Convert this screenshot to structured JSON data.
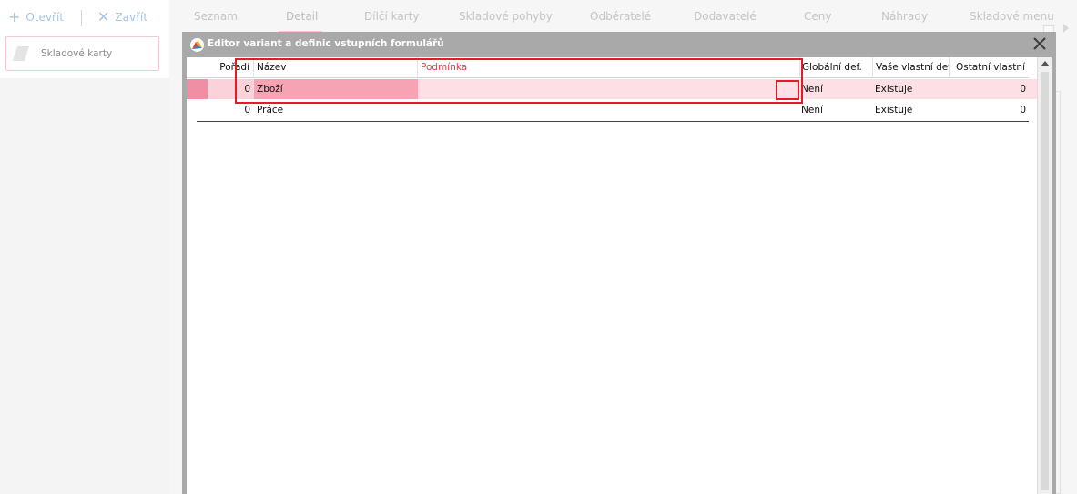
{
  "toolbar": {
    "open_label": "Otevřít",
    "close_label": "Zavřít"
  },
  "module_card": {
    "label": "Skladové karty"
  },
  "tabs": [
    {
      "label": "Seznam"
    },
    {
      "label": "Detail",
      "active": true
    },
    {
      "label": "Dílčí karty"
    },
    {
      "label": "Skladové pohyby"
    },
    {
      "label": "Odběratelé"
    },
    {
      "label": "Dodavatelé"
    },
    {
      "label": "Ceny"
    },
    {
      "label": "Náhrady"
    },
    {
      "label": "Skladové menu"
    }
  ],
  "dialog": {
    "title": "Editor variant a definic vstupních formulářů",
    "columns": {
      "order": "Pořadí",
      "name": "Název",
      "condition": "Podmínka",
      "global": "Globální def.",
      "own": "Vaše vlastní def.",
      "other": "Ostatní vlastní"
    },
    "rows": [
      {
        "order": "0",
        "name": "Zboží",
        "condition": "",
        "global": "Není",
        "own": "Existuje",
        "other": "0",
        "selected": true
      },
      {
        "order": "0",
        "name": "Práce",
        "condition": "",
        "global": "Není",
        "own": "Existuje",
        "other": "0",
        "selected": false
      }
    ]
  },
  "colors": {
    "accent_red": "#e3192c",
    "selected_row": "#f6a3b3",
    "selected_row_light": "#fde0e6",
    "dialog_frame": "#a9a9a9",
    "dropdown_arrow": "#4a9fdc"
  },
  "icons": {
    "open": "plus-icon",
    "close": "x-icon",
    "dialog_close": "close-icon",
    "dropdown": "chevron-down-icon",
    "scroll_up": "scroll-up-arrow-icon"
  }
}
